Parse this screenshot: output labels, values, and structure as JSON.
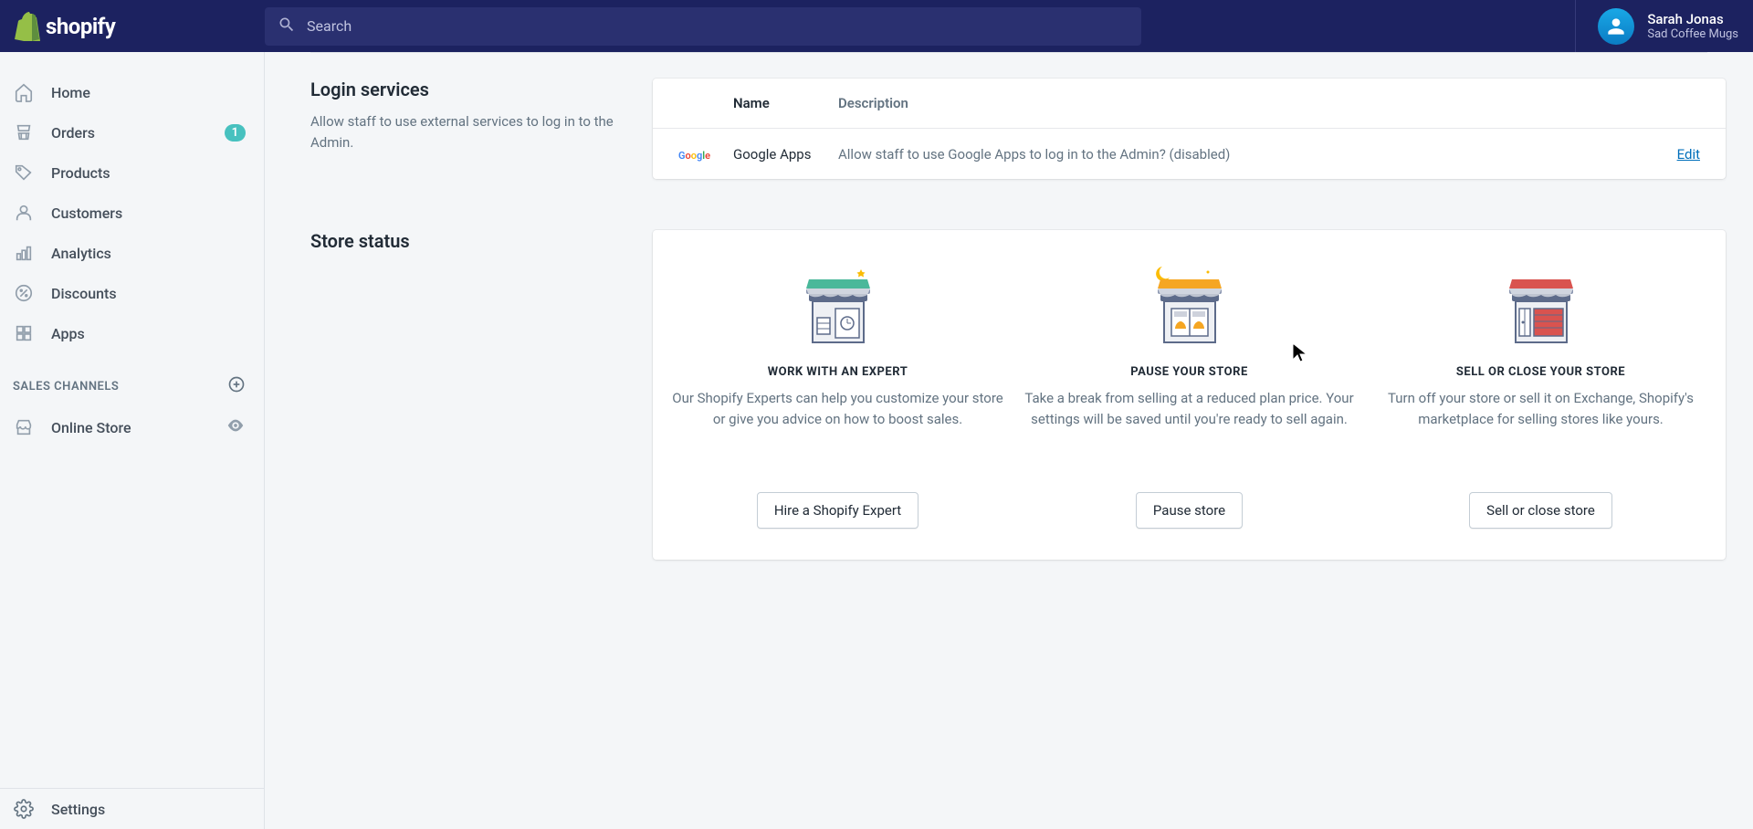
{
  "header": {
    "search_placeholder": "Search",
    "user_name": "Sarah Jonas",
    "store_name": "Sad Coffee Mugs"
  },
  "sidebar": {
    "items": [
      {
        "label": "Home",
        "icon": "home"
      },
      {
        "label": "Orders",
        "icon": "orders",
        "badge": "1"
      },
      {
        "label": "Products",
        "icon": "products"
      },
      {
        "label": "Customers",
        "icon": "customers"
      },
      {
        "label": "Analytics",
        "icon": "analytics"
      },
      {
        "label": "Discounts",
        "icon": "discounts"
      },
      {
        "label": "Apps",
        "icon": "apps"
      }
    ],
    "channels_header": "SALES CHANNELS",
    "channels": [
      {
        "label": "Online Store",
        "icon": "online-store"
      }
    ],
    "settings": "Settings"
  },
  "login_services": {
    "title": "Login services",
    "desc": "Allow staff to use external services to log in to the Admin.",
    "table": {
      "headers": {
        "name": "Name",
        "description": "Description"
      },
      "rows": [
        {
          "name": "Google Apps",
          "description": "Allow staff to use Google Apps to log in to the Admin? (disabled)",
          "action": "Edit"
        }
      ]
    }
  },
  "store_status": {
    "title": "Store status",
    "cards": [
      {
        "heading": "WORK WITH AN EXPERT",
        "body": "Our Shopify Experts can help you customize your store or give you advice on how to boost sales.",
        "button": "Hire a Shopify Expert"
      },
      {
        "heading": "PAUSE YOUR STORE",
        "body": "Take a break from selling at a reduced plan price. Your settings will be saved until you're ready to sell again.",
        "button": "Pause store"
      },
      {
        "heading": "SELL OR CLOSE YOUR STORE",
        "body": "Turn off your store or sell it on Exchange, Shopify's marketplace for selling stores like yours.",
        "button": "Sell or close store"
      }
    ]
  }
}
